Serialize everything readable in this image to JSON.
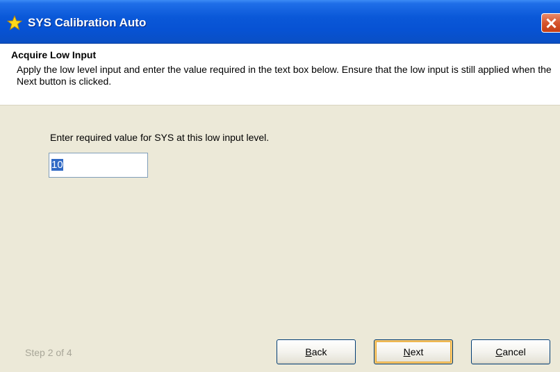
{
  "window": {
    "title": "SYS Calibration Auto",
    "title_icon": "star-icon",
    "close_icon": "close-icon"
  },
  "header": {
    "title": "Acquire Low Input",
    "description": "Apply the low level input and enter the value required in the text box below. Ensure that the low input is still applied when the Next button is clicked."
  },
  "form": {
    "prompt": "Enter required value for SYS at this low input level.",
    "value": "10"
  },
  "footer": {
    "step": "Step 2 of 4",
    "back_label_rest": "ack",
    "back_mnemonic": "B",
    "next_label_rest": "ext",
    "next_mnemonic": "N",
    "cancel_label_rest": "ancel",
    "cancel_mnemonic": "C"
  },
  "colors": {
    "titlebar": "#0752d3",
    "dialog_bg": "#ece9d8",
    "selection": "#316ac5",
    "step_text": "#a8a698"
  }
}
